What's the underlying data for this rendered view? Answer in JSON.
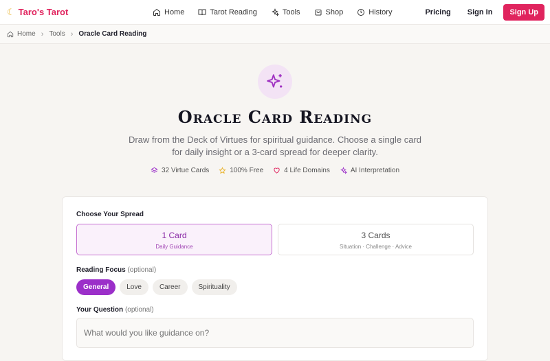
{
  "header": {
    "brand": "Taro's Tarot",
    "nav": [
      {
        "label": "Home",
        "icon": "home-icon"
      },
      {
        "label": "Tarot Reading",
        "icon": "book-icon"
      },
      {
        "label": "Tools",
        "icon": "sparkle-icon"
      },
      {
        "label": "Shop",
        "icon": "shop-icon"
      },
      {
        "label": "History",
        "icon": "clock-icon"
      }
    ],
    "pricing": "Pricing",
    "signin": "Sign In",
    "signup": "Sign Up"
  },
  "breadcrumb": {
    "home": "Home",
    "tools": "Tools",
    "current": "Oracle Card Reading"
  },
  "hero": {
    "title": "Oracle Card Reading",
    "description": "Draw from the Deck of Virtues for spiritual guidance. Choose a single card for daily insight or a 3-card spread for deeper clarity.",
    "features": [
      {
        "label": "32 Virtue Cards",
        "icon": "layers-icon"
      },
      {
        "label": "100% Free",
        "icon": "star-icon"
      },
      {
        "label": "4 Life Domains",
        "icon": "heart-icon"
      },
      {
        "label": "AI Interpretation",
        "icon": "sparkle-icon"
      }
    ]
  },
  "form": {
    "spread_label": "Choose Your Spread",
    "spreads": [
      {
        "title": "1 Card",
        "subtitle": "Daily Guidance"
      },
      {
        "title": "3 Cards",
        "subtitle": "Situation · Challenge · Advice"
      }
    ],
    "focus_label": "Reading Focus",
    "focus_optional": "(optional)",
    "focus_options": [
      "General",
      "Love",
      "Career",
      "Spirituality"
    ],
    "question_label": "Your Question",
    "question_optional": "(optional)",
    "question_placeholder": "What would you like guidance on?"
  },
  "colors": {
    "brand": "#e0245e",
    "accent": "#9b2fc9"
  }
}
